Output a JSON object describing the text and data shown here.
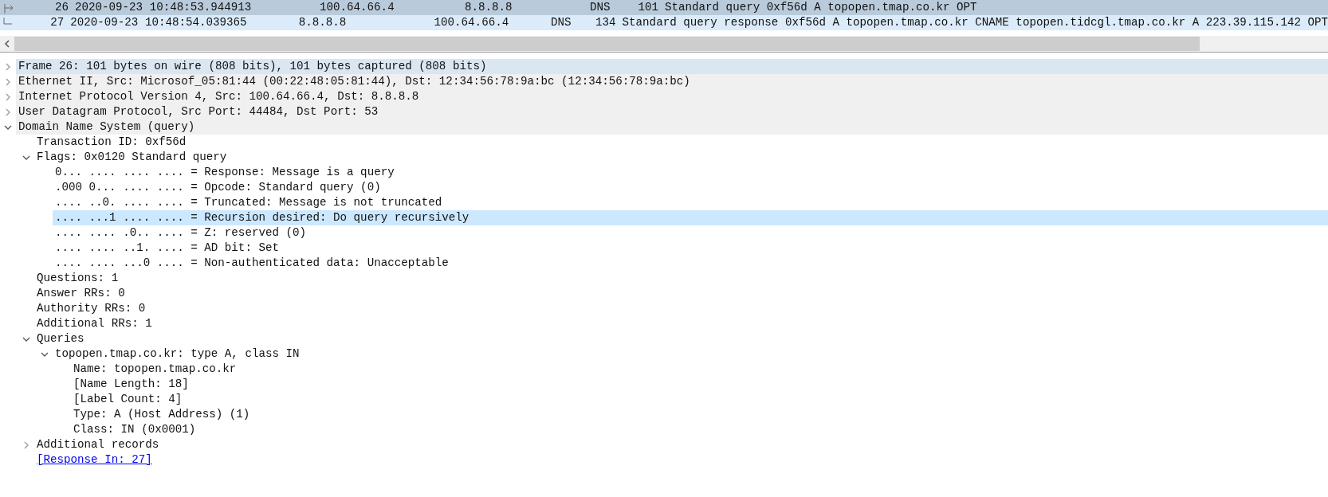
{
  "packet_list": {
    "rows": [
      {
        "no": "26",
        "time": "2020-09-23 10:48:53.944913",
        "source": "100.64.66.4",
        "destination": "8.8.8.8",
        "protocol": "DNS",
        "length": "101",
        "info": "Standard query 0xf56d A topopen.tmap.co.kr OPT",
        "selected": true,
        "kind": "request"
      },
      {
        "no": "27",
        "time": "2020-09-23 10:48:54.039365",
        "source": "8.8.8.8",
        "destination": "100.64.66.4",
        "protocol": "DNS",
        "length": "134",
        "info": "Standard query response 0xf56d A topopen.tmap.co.kr CNAME topopen.tidcgl.tmap.co.kr A 223.39.115.142 OPT",
        "selected": false,
        "kind": "response"
      }
    ]
  },
  "details": [
    {
      "label": "Frame 26: 101 bytes on wire (808 bits), 101 bytes captured (808 bits)",
      "expanded": false,
      "hovered": true,
      "selected": false
    },
    {
      "label": "Ethernet II, Src: Microsof_05:81:44 (00:22:48:05:81:44), Dst: 12:34:56:78:9a:bc (12:34:56:78:9a:bc)",
      "expanded": false,
      "hovered": false,
      "selected": false
    },
    {
      "label": "Internet Protocol Version 4, Src: 100.64.66.4, Dst: 8.8.8.8",
      "expanded": false,
      "hovered": false,
      "selected": false
    },
    {
      "label": "User Datagram Protocol, Src Port: 44484, Dst Port: 53",
      "expanded": false,
      "hovered": false,
      "selected": false
    },
    {
      "label": "Domain Name System (query)",
      "expanded": true,
      "hovered": false,
      "selected": false,
      "children": [
        {
          "label": "Transaction ID: 0xf56d",
          "selected": false
        },
        {
          "label": "Flags: 0x0120 Standard query",
          "expanded": true,
          "selected": false,
          "children": [
            {
              "label": "0... .... .... .... = Response: Message is a query",
              "selected": false
            },
            {
              "label": ".000 0... .... .... = Opcode: Standard query (0)",
              "selected": false
            },
            {
              "label": ".... ..0. .... .... = Truncated: Message is not truncated",
              "selected": false
            },
            {
              "label": ".... ...1 .... .... = Recursion desired: Do query recursively",
              "selected": true
            },
            {
              "label": ".... .... .0.. .... = Z: reserved (0)",
              "selected": false
            },
            {
              "label": ".... .... ..1. .... = AD bit: Set",
              "selected": false
            },
            {
              "label": ".... .... ...0 .... = Non-authenticated data: Unacceptable",
              "selected": false
            }
          ]
        },
        {
          "label": "Questions: 1",
          "selected": false
        },
        {
          "label": "Answer RRs: 0",
          "selected": false
        },
        {
          "label": "Authority RRs: 0",
          "selected": false
        },
        {
          "label": "Additional RRs: 1",
          "selected": false
        },
        {
          "label": "Queries",
          "expanded": true,
          "selected": false,
          "children": [
            {
              "label": "topopen.tmap.co.kr: type A, class IN",
              "expanded": true,
              "selected": false,
              "children": [
                {
                  "label": "Name: topopen.tmap.co.kr",
                  "selected": false
                },
                {
                  "label": "[Name Length: 18]",
                  "selected": false
                },
                {
                  "label": "[Label Count: 4]",
                  "selected": false
                },
                {
                  "label": "Type: A (Host Address) (1)",
                  "selected": false
                },
                {
                  "label": "Class: IN (0x0001)",
                  "selected": false
                }
              ]
            }
          ]
        },
        {
          "label": "Additional records",
          "expanded": false,
          "selected": false
        },
        {
          "label": "[Response In: 27]",
          "kind": "link",
          "selected": false
        }
      ]
    }
  ]
}
